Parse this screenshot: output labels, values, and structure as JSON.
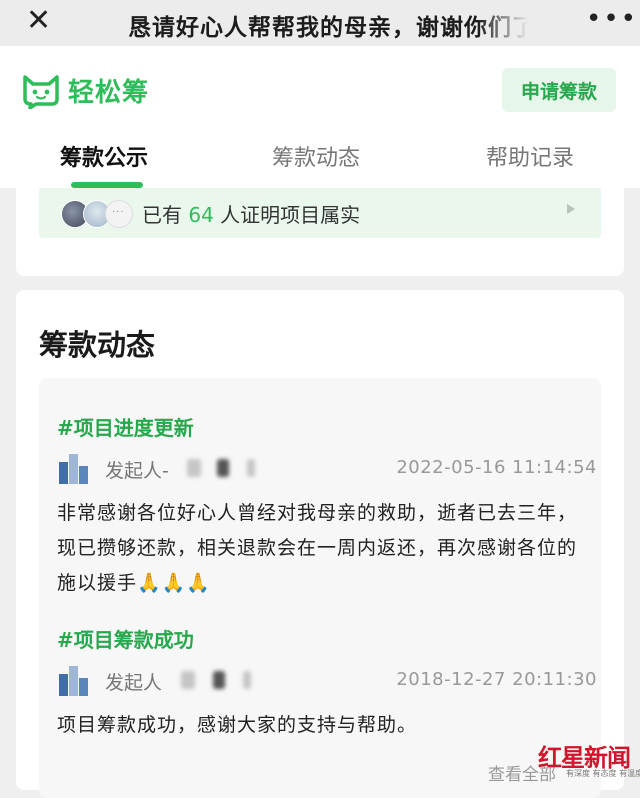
{
  "topbar": {
    "close_icon": "close-icon",
    "title": "恳请好心人帮帮我的母亲，谢谢你们了",
    "more_icon": "more-icon"
  },
  "header": {
    "logo_text": "轻松筹",
    "apply_button": "申请筹款",
    "tabs": [
      "筹款公示",
      "筹款动态",
      "帮助记录"
    ],
    "active_tab": 0
  },
  "verify": {
    "prefix": "已有",
    "count": "64",
    "suffix": "人证明项目属实"
  },
  "updates": {
    "title": "筹款动态",
    "items": [
      {
        "tag": "#项目进度更新",
        "author": "发起人-",
        "time": "2022-05-16 11:14:54",
        "body": "非常感谢各位好心人曾经对我母亲的救助，逝者已去三年，现已攒够还款，相关退款会在一周内返还，再次感谢各位的施以援手🙏🙏🙏"
      },
      {
        "tag": "#项目筹款成功",
        "author": "发起人",
        "time": "2018-12-27 20:11:30",
        "body": "项目筹款成功，感谢大家的支持与帮助。"
      }
    ],
    "view_all": "查看全部"
  },
  "watermark": {
    "main": "红星新闻",
    "sub": "有深度 有态度 有温度"
  },
  "colors": {
    "brand_green": "#2fbd5a",
    "watermark_red": "#d0162a"
  }
}
